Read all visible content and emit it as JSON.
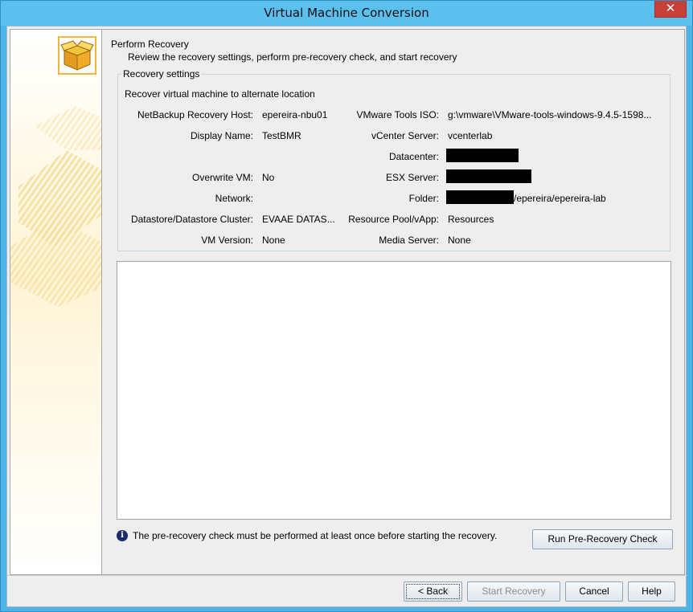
{
  "window": {
    "title": "Virtual Machine Conversion",
    "close_glyph": "✕"
  },
  "page": {
    "heading": "Perform Recovery",
    "subheading": "Review the recovery settings, perform pre-recovery check, and start recovery"
  },
  "settings": {
    "group_title": "Recovery settings",
    "subtitle": "Recover virtual machine to alternate location",
    "left": [
      {
        "label": "NetBackup Recovery Host:",
        "value": "epereira-nbu01"
      },
      {
        "label": "Display Name:",
        "value": "TestBMR"
      },
      {
        "label": "Overwrite VM:",
        "value": "No"
      },
      {
        "label": "Network:",
        "value": ""
      },
      {
        "label": "Datastore/Datastore Cluster:",
        "value": "EVAAE DATAS..."
      },
      {
        "label": "VM Version:",
        "value": "None"
      }
    ],
    "right": [
      {
        "label": "VMware Tools ISO:",
        "value": "g:\\vmware\\VMware-tools-windows-9.4.5-1598..."
      },
      {
        "label": "vCenter Server:",
        "value": "vcenterlab"
      },
      {
        "label": "Datacenter:",
        "value": ""
      },
      {
        "label": "ESX Server:",
        "value": ""
      },
      {
        "label": "Folder:",
        "value": "/epereira/epereira-lab"
      },
      {
        "label": "Resource Pool/vApp:",
        "value": "Resources"
      },
      {
        "label": "Media Server:",
        "value": "None"
      }
    ]
  },
  "info": {
    "icon": "info-icon",
    "glyph": "i",
    "text": "The pre-recovery check must be performed at least once before starting the recovery."
  },
  "buttons": {
    "run_check": "Run Pre-Recovery Check",
    "back": "< Back",
    "start": "Start Recovery",
    "cancel": "Cancel",
    "help": "Help"
  },
  "colors": {
    "title_bar": "#5cc0ef",
    "close_button": "#c7403a",
    "wizard_icon_border": "#f0b63a",
    "info_icon": "#1b2a6b"
  }
}
